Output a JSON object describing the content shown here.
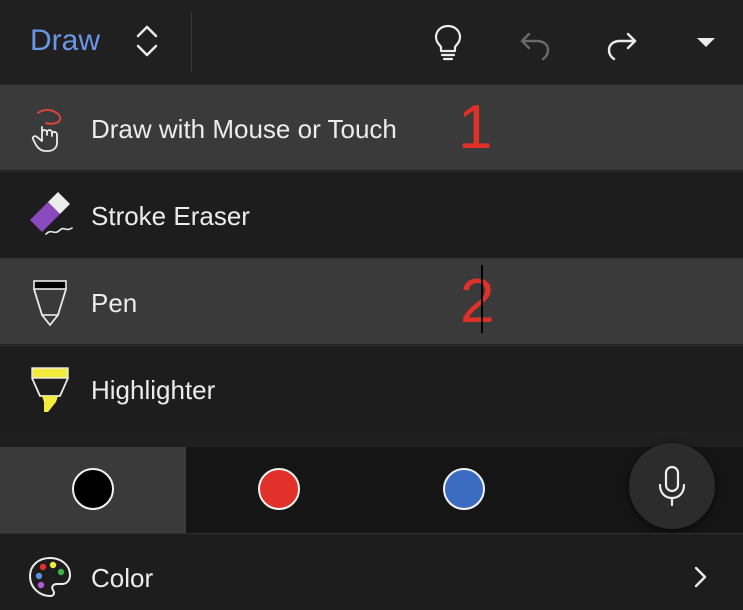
{
  "toolbar": {
    "tab_title": "Draw",
    "icons": [
      "updown-icon",
      "lightbulb-icon",
      "undo-icon",
      "redo-icon",
      "dropdown-icon"
    ],
    "undo_enabled": false
  },
  "menu": {
    "items": [
      {
        "label": "Draw with Mouse or Touch",
        "icon": "draw-touch-icon",
        "highlighted": true
      },
      {
        "label": "Stroke Eraser",
        "icon": "stroke-eraser-icon",
        "highlighted": false
      },
      {
        "label": "Pen",
        "icon": "pen-icon",
        "highlighted": true
      },
      {
        "label": "Highlighter",
        "icon": "highlighter-icon",
        "highlighted": false
      }
    ]
  },
  "annotations": {
    "marker_1": "1",
    "marker_2": "2"
  },
  "colors": {
    "swatches": [
      {
        "color": "#000000",
        "selected": true
      },
      {
        "color": "#e2302a",
        "selected": false
      },
      {
        "color": "#3c6bc2",
        "selected": false
      }
    ],
    "mic_icon": "microphone-icon"
  },
  "color_menu": {
    "label": "Color",
    "icon": "palette-icon",
    "chevron": "chevron-right-icon"
  },
  "theme": {
    "accent": "#6b95e6",
    "marker": "#e0302a",
    "highlight_row": "#3a3a3a"
  }
}
